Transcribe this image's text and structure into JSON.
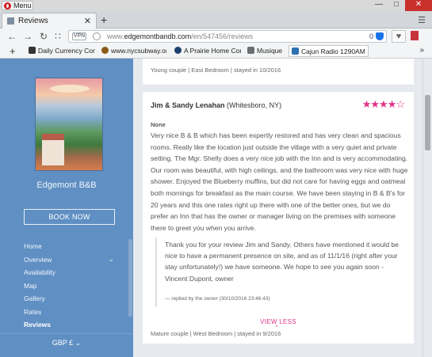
{
  "browser": {
    "menu_label": "Menu",
    "tab_title": "Reviews",
    "new_tab": "+",
    "url_prefix": "www.",
    "url_domain": "edgemontbandb.com",
    "url_path": "/en/547456/reviews",
    "vpn_label": "VPN",
    "adblock_count": "0",
    "bookmarks": [
      {
        "label": "Daily Currency Conve",
        "icon_color": "#333333"
      },
      {
        "label": "www.nycsubway.org",
        "icon_color": "#8a5a16"
      },
      {
        "label": "A Prairie Home Comp",
        "icon_color": "#1b3f6e"
      },
      {
        "label": "Musique",
        "icon_color": "#6b6f73"
      },
      {
        "label": "Cajun Radio 1290AM",
        "icon_color": "#2f6fb3"
      }
    ]
  },
  "sidebar": {
    "brand": "Edgemont B&B",
    "book_now": "BOOK NOW",
    "nav": [
      "Home",
      "Overview",
      "Availability",
      "Map",
      "Gallery",
      "Rates",
      "Reviews"
    ],
    "active": "Reviews",
    "currency": "GBP £"
  },
  "reviews": {
    "previous_meta": "Young couple  |  East Bedroom  |  stayed in 10/2016",
    "reviewer_name": "Jim & Sandy Lenahan",
    "reviewer_location": "(Whitesboro, NY)",
    "rating": 4,
    "rating_max": 5,
    "title": "None",
    "body": "Very nice B & B which has been expertly restored and has very clean and spacious rooms. Really like the location just outside the village with a very quiet and private setting. The Mgr. Shelly does a very nice job with the Inn and is very accommodating. Our room was beautiful, with high ceilings, and the bathroom was very nice with huge shower. Enjoyed the Blueberry muffins, but did not care for having eggs and oatmeal both mornings for breakfast as the main course. We have been staying in B & B's for 20 years and this one rates right up there with one of the better ones, but we do prefer an Inn that has the owner or manager living on the premises with someone there to greet you when you arrive.",
    "reply": "Thank you for your review Jim and Sandy. Others have mentioned it would be nice to have a permanent presence on site, and as of 11/1/16 (right after your stay unfortunately!) we have someone. We hope to see you again soon - Vincent Dupont, owner",
    "reply_by": "— replied by the owner (30/10/2016 23:46:43)",
    "view_less": "VIEW LESS",
    "meta": "Mature couple  |  West Bedroom  |  stayed in 9/2016"
  },
  "colors": {
    "accent": "#e0338b",
    "sidebar": "#5f8fc3"
  }
}
